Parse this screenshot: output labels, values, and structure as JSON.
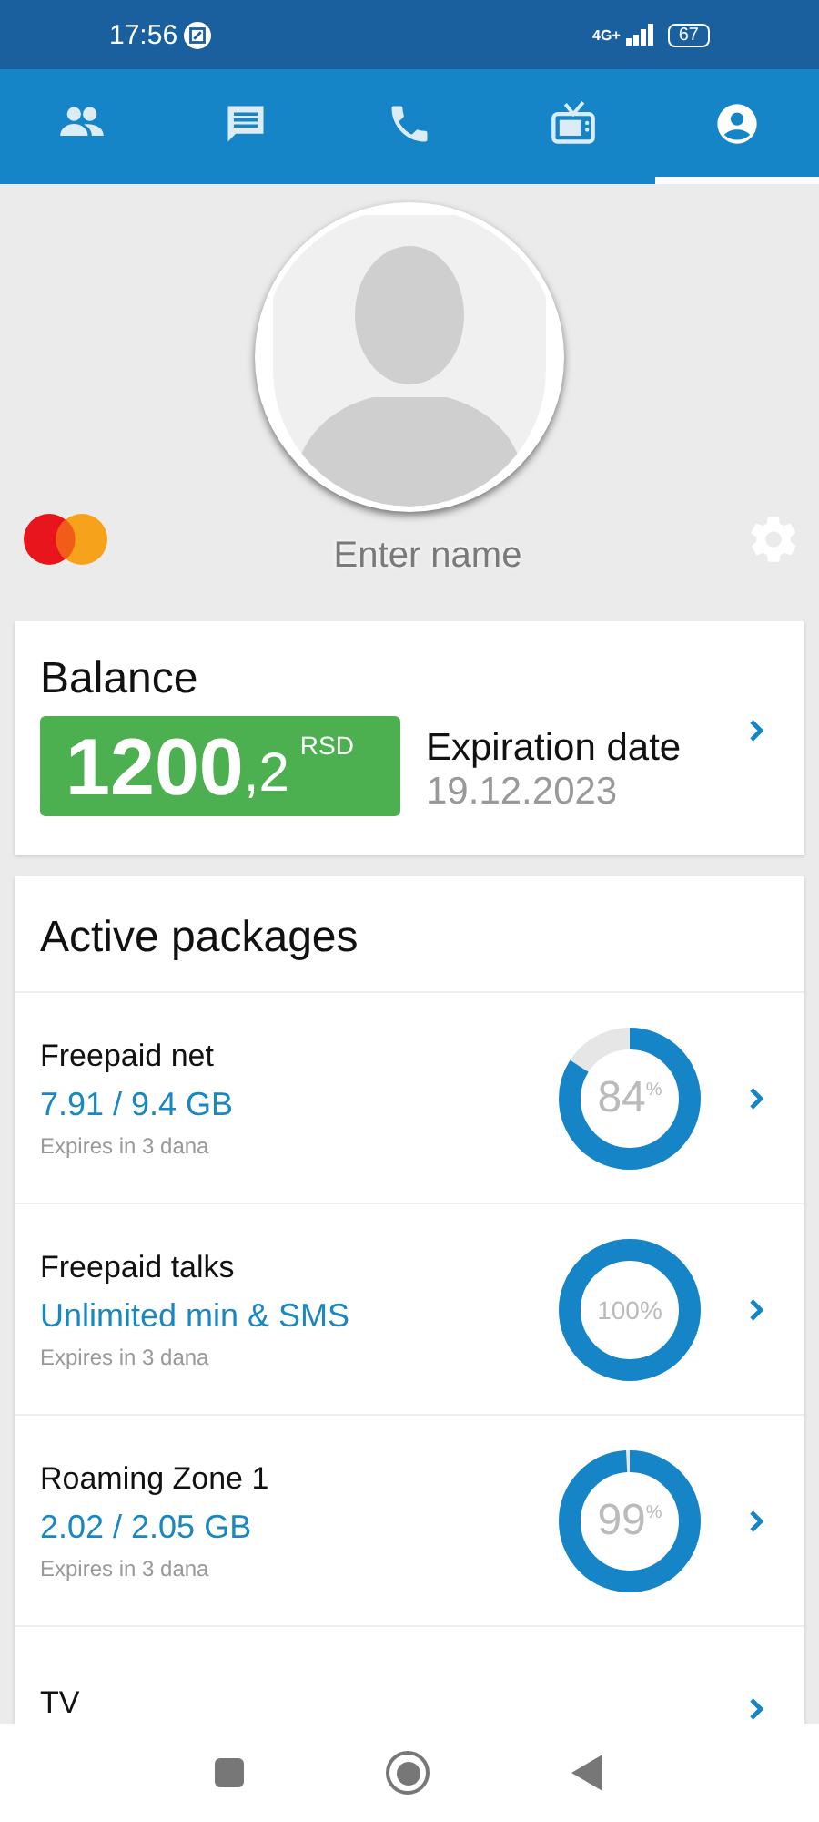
{
  "status_bar": {
    "time": "17:56",
    "network": "4G+",
    "battery": "67"
  },
  "tabs": [
    {
      "kind": "people",
      "selected": false
    },
    {
      "kind": "chat",
      "selected": false
    },
    {
      "kind": "phone",
      "selected": false
    },
    {
      "kind": "tv",
      "selected": false
    },
    {
      "kind": "account",
      "selected": true
    }
  ],
  "profile": {
    "name_placeholder": "Enter name"
  },
  "balance": {
    "title": "Balance",
    "amount": "1200",
    "decimals": ",2",
    "currency": "RSD",
    "expiration_label": "Expiration date",
    "expiration_date": "19.12.2023"
  },
  "packages": {
    "title": "Active packages",
    "items": [
      {
        "name": "Freepaid net",
        "usage": "7.91 / 9.4 GB",
        "expires": "Expires in 3 dana",
        "level": 0.84,
        "percent": "84$^{%}$"
      },
      {
        "name": "Freepaid talks",
        "usage": "Unlimited min & SMS",
        "expires": "Expires in 3 dana",
        "level": 1,
        "percent": "100%"
      },
      {
        "name": "Roaming Zone 1",
        "usage": "2.02 / 2.05 GB",
        "expires": "Expires in 3 dana",
        "level": 0.99,
        "percent": "99$^{%}$"
      },
      {
        "name": "TV"
      }
    ]
  }
}
